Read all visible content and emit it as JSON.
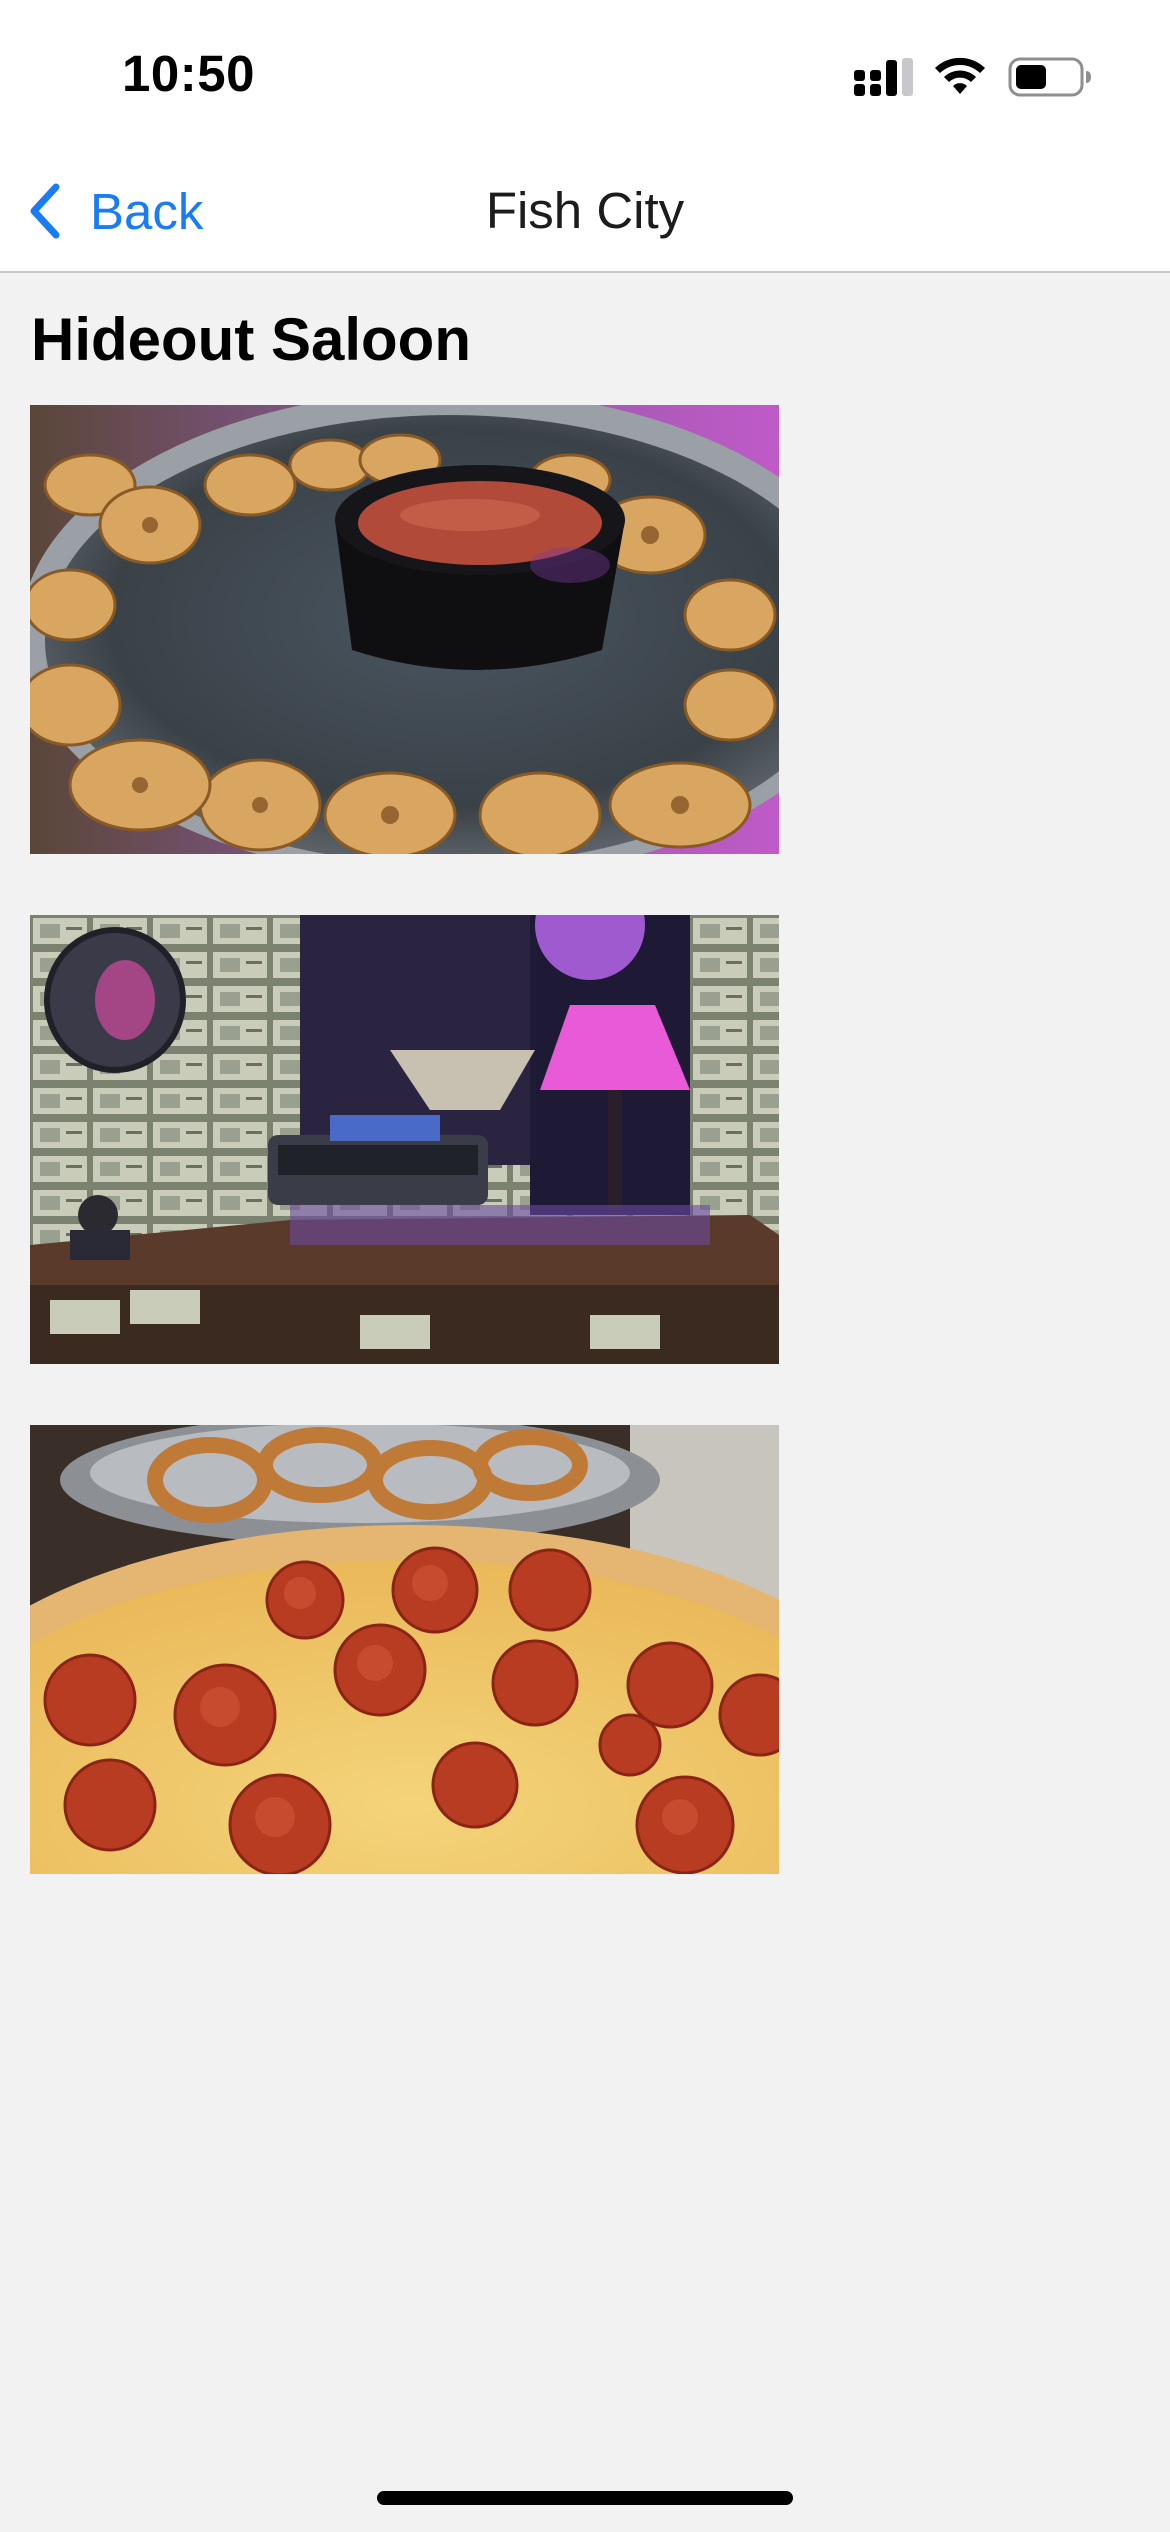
{
  "status_bar": {
    "time": "10:50",
    "icons": [
      "cellular-signal-icon",
      "wifi-icon",
      "battery-icon"
    ]
  },
  "nav": {
    "back_label": "Back",
    "title": "Fish City",
    "accent_color": "#1a7cf5"
  },
  "place": {
    "name": "Hideout Saloon",
    "photos": [
      {
        "subject": "grilled shrimp platter with dipping sauce"
      },
      {
        "subject": "bar counter with dollar bills on walls and leg lamp"
      },
      {
        "subject": "pepperoni pizza with onion rings"
      }
    ]
  }
}
